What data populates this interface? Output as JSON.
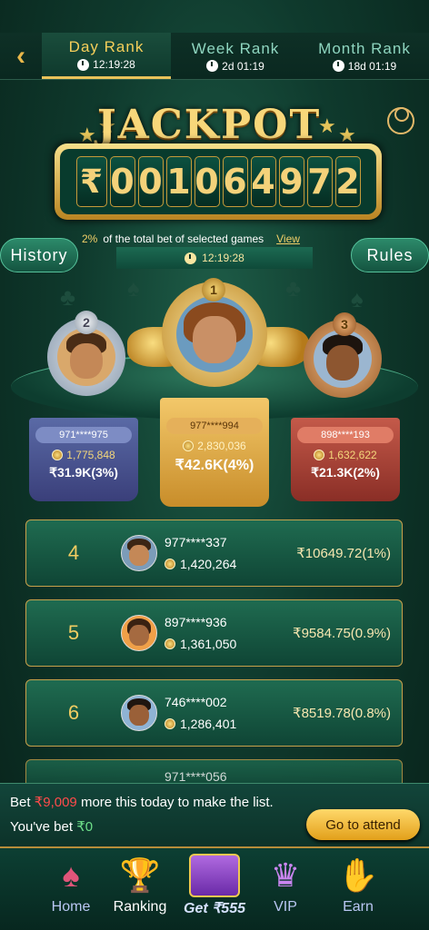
{
  "tabs": [
    {
      "label": "Day Rank",
      "timer": "12:19:28",
      "active": true
    },
    {
      "label": "Week Rank",
      "timer": "2d 01:19",
      "active": false
    },
    {
      "label": "Month Rank",
      "timer": "18d 01:19",
      "active": false
    }
  ],
  "jackpot": {
    "title": "JACKPOT",
    "currency": "₹",
    "digits": [
      "0",
      "0",
      "1",
      "0",
      "6",
      "4",
      "9",
      "7",
      "2"
    ],
    "percent": "2%",
    "description": "of the total bet of selected games",
    "view_label": "View",
    "timer": "12:19:28"
  },
  "buttons": {
    "history": "History",
    "rules": "Rules"
  },
  "podium": [
    {
      "rank": "2",
      "uid": "971****975",
      "coins": "1,775,848",
      "prize": "₹31.9K(3%)"
    },
    {
      "rank": "1",
      "uid": "977****994",
      "coins": "2,830,036",
      "prize": "₹42.6K(4%)"
    },
    {
      "rank": "3",
      "uid": "898****193",
      "coins": "1,632,622",
      "prize": "₹21.3K(2%)"
    }
  ],
  "list": [
    {
      "rank": "4",
      "uid": "977****337",
      "coins": "1,420,264",
      "reward": "₹10649.72(1%)"
    },
    {
      "rank": "5",
      "uid": "897****936",
      "coins": "1,361,050",
      "reward": "₹9584.75(0.9%)"
    },
    {
      "rank": "6",
      "uid": "746****002",
      "coins": "1,286,401",
      "reward": "₹8519.78(0.8%)"
    },
    {
      "rank": "",
      "uid": "971****056",
      "coins": "",
      "reward": ""
    }
  ],
  "bet_info": {
    "prefix": "Bet",
    "amount": "₹9,009",
    "suffix": "more this today to make the list.",
    "bet_label": "You've bet",
    "bet_value": "₹0",
    "attend_label": "Go to attend"
  },
  "nav": [
    {
      "label": "Home",
      "icon": "home-icon"
    },
    {
      "label": "Ranking",
      "icon": "trophy-icon"
    },
    {
      "label": "Get ₹555",
      "icon": "treasure-chest-icon"
    },
    {
      "label": "VIP",
      "icon": "vip-crown-icon"
    },
    {
      "label": "Earn",
      "icon": "handshake-icon"
    }
  ]
}
